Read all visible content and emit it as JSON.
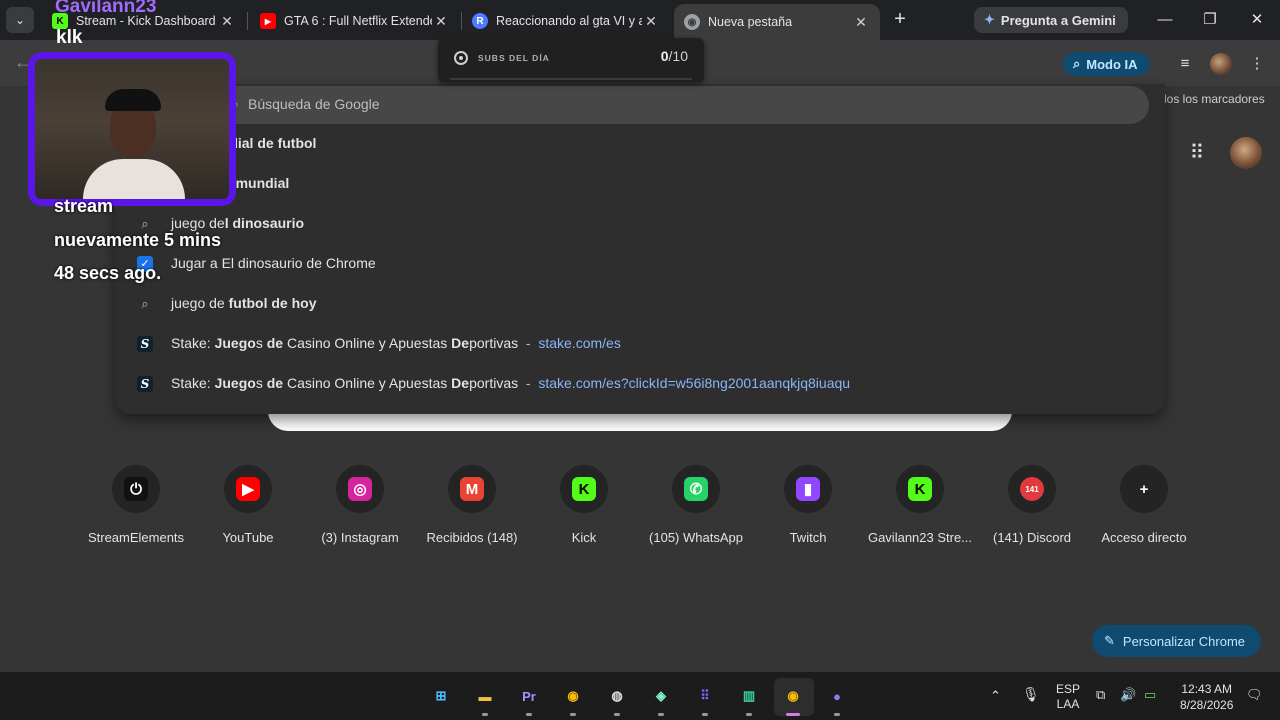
{
  "tabs": [
    {
      "title": "Stream - Kick Dashboard",
      "favicon": "kick-icon",
      "color": "#53fc18"
    },
    {
      "title": "GTA 6 : Full Netflix Extended",
      "favicon": "youtube-icon",
      "color": "#ff0000"
    },
    {
      "title": "Reaccionando al gta VI y a",
      "favicon": "r-icon",
      "color": "#4f7bff"
    },
    {
      "title": "Nueva pestaña",
      "favicon": "chrome-icon",
      "color": "#9aa0a6"
    }
  ],
  "gemini_label": "Pregunta a Gemini",
  "modo_ia_label": "Modo IA",
  "bookmarks_label": "dos los marcadores",
  "omnibox": {
    "placeholder": "Búsqueda de Google",
    "suggestions": [
      {
        "icon": "search-icon",
        "plain": "",
        "bold": "hoy mundial de futbol",
        "plain2": "",
        "bold2": "",
        "url": ""
      },
      {
        "icon": "search-icon",
        "plain": "",
        "bold": "hoy en el mundial",
        "plain2": "",
        "bold2": "",
        "url": ""
      },
      {
        "icon": "search-icon",
        "plain": "juego de",
        "bold": "l dinosaurio",
        "plain2": "",
        "bold2": "",
        "url": ""
      },
      {
        "icon": "dino-game-icon",
        "plain": "Jugar a El dinosaurio de Chrome",
        "bold": "",
        "plain2": "",
        "bold2": "",
        "url": ""
      },
      {
        "icon": "search-icon",
        "plain": "juego de ",
        "bold": "futbol de hoy",
        "plain2": "",
        "bold2": "",
        "url": ""
      },
      {
        "icon": "stake-icon",
        "plain": "Stake: ",
        "bold": "Juego",
        "plain2": "s ",
        "bold2": "de",
        "tail": " Casino Online y Apuestas ",
        "bold3": "De",
        "tail2": "portivas",
        "url": "stake.com/es"
      },
      {
        "icon": "stake-icon",
        "plain": "Stake: ",
        "bold": "Juego",
        "plain2": "s ",
        "bold2": "de",
        "tail": " Casino Online y Apuestas ",
        "bold3": "De",
        "tail2": "portivas",
        "url": "stake.com/es?clickId=w56i8ng2001aanqkjq8iuaqu"
      }
    ]
  },
  "subs_widget": {
    "label": "SUBS DEL DÍA",
    "current": "0",
    "separator": "/",
    "total": "10",
    "progress_fraction": 0.0
  },
  "shortcuts": [
    {
      "label": "StreamElements",
      "icon": "streamelements-icon",
      "glyph": "⏻",
      "bg": "#111111"
    },
    {
      "label": "YouTube",
      "icon": "youtube-icon",
      "glyph": "▶",
      "bg": "#ff0000"
    },
    {
      "label": "(3) Instagram",
      "icon": "instagram-icon",
      "glyph": "◎",
      "bg": "#d6249f"
    },
    {
      "label": "Recibidos (148)",
      "icon": "gmail-icon",
      "glyph": "M",
      "bg": "#ea4335"
    },
    {
      "label": "Kick",
      "icon": "kick-icon",
      "glyph": "K",
      "bg": "#53fc18"
    },
    {
      "label": "(105) WhatsApp",
      "icon": "whatsapp-icon",
      "glyph": "✆",
      "bg": "#25d366"
    },
    {
      "label": "Twitch",
      "icon": "twitch-icon",
      "glyph": "▮",
      "bg": "#9146ff"
    },
    {
      "label": "Gavilann23 Stre...",
      "icon": "kick-icon",
      "glyph": "K",
      "bg": "#53fc18"
    },
    {
      "label": "(141) Discord",
      "icon": "discord-icon",
      "glyph": "141",
      "bg": "#e03a3e"
    },
    {
      "label": "Acceso directo",
      "icon": "add-shortcut-icon",
      "glyph": "+",
      "bg": "#242424"
    }
  ],
  "personalizar_label": "Personalizar Chrome",
  "overlay": {
    "username": "Gavilann23",
    "chat": "klk",
    "messages": [
      "stream",
      "nuevamente 5 mins",
      "48 secs ago."
    ]
  },
  "taskbar": {
    "apps": [
      {
        "name": "windows-start-icon",
        "glyph": "⊞",
        "color": "#4cc2ff"
      },
      {
        "name": "file-explorer-icon",
        "glyph": "▬",
        "color": "#f3c23c"
      },
      {
        "name": "premiere-pro-icon",
        "glyph": "Pr",
        "color": "#9999ff"
      },
      {
        "name": "chrome-icon",
        "glyph": "◉",
        "color": "#fbbc04"
      },
      {
        "name": "obs-icon",
        "glyph": "◍",
        "color": "#dddddd"
      },
      {
        "name": "streamlabs-icon",
        "glyph": "◈",
        "color": "#80f5d2"
      },
      {
        "name": "launcher-icon",
        "glyph": "⠿",
        "color": "#8a5cff"
      },
      {
        "name": "audio-app-icon",
        "glyph": "▥",
        "color": "#3ad0a0"
      },
      {
        "name": "chrome-active-icon",
        "glyph": "◉",
        "color": "#fbbc04"
      },
      {
        "name": "chat-app-icon",
        "glyph": "●",
        "color": "#8a7cf5"
      }
    ],
    "lang_top": "ESP",
    "lang_bottom": "LAA",
    "time": "12:43 AM",
    "date": "8/28/2026"
  }
}
